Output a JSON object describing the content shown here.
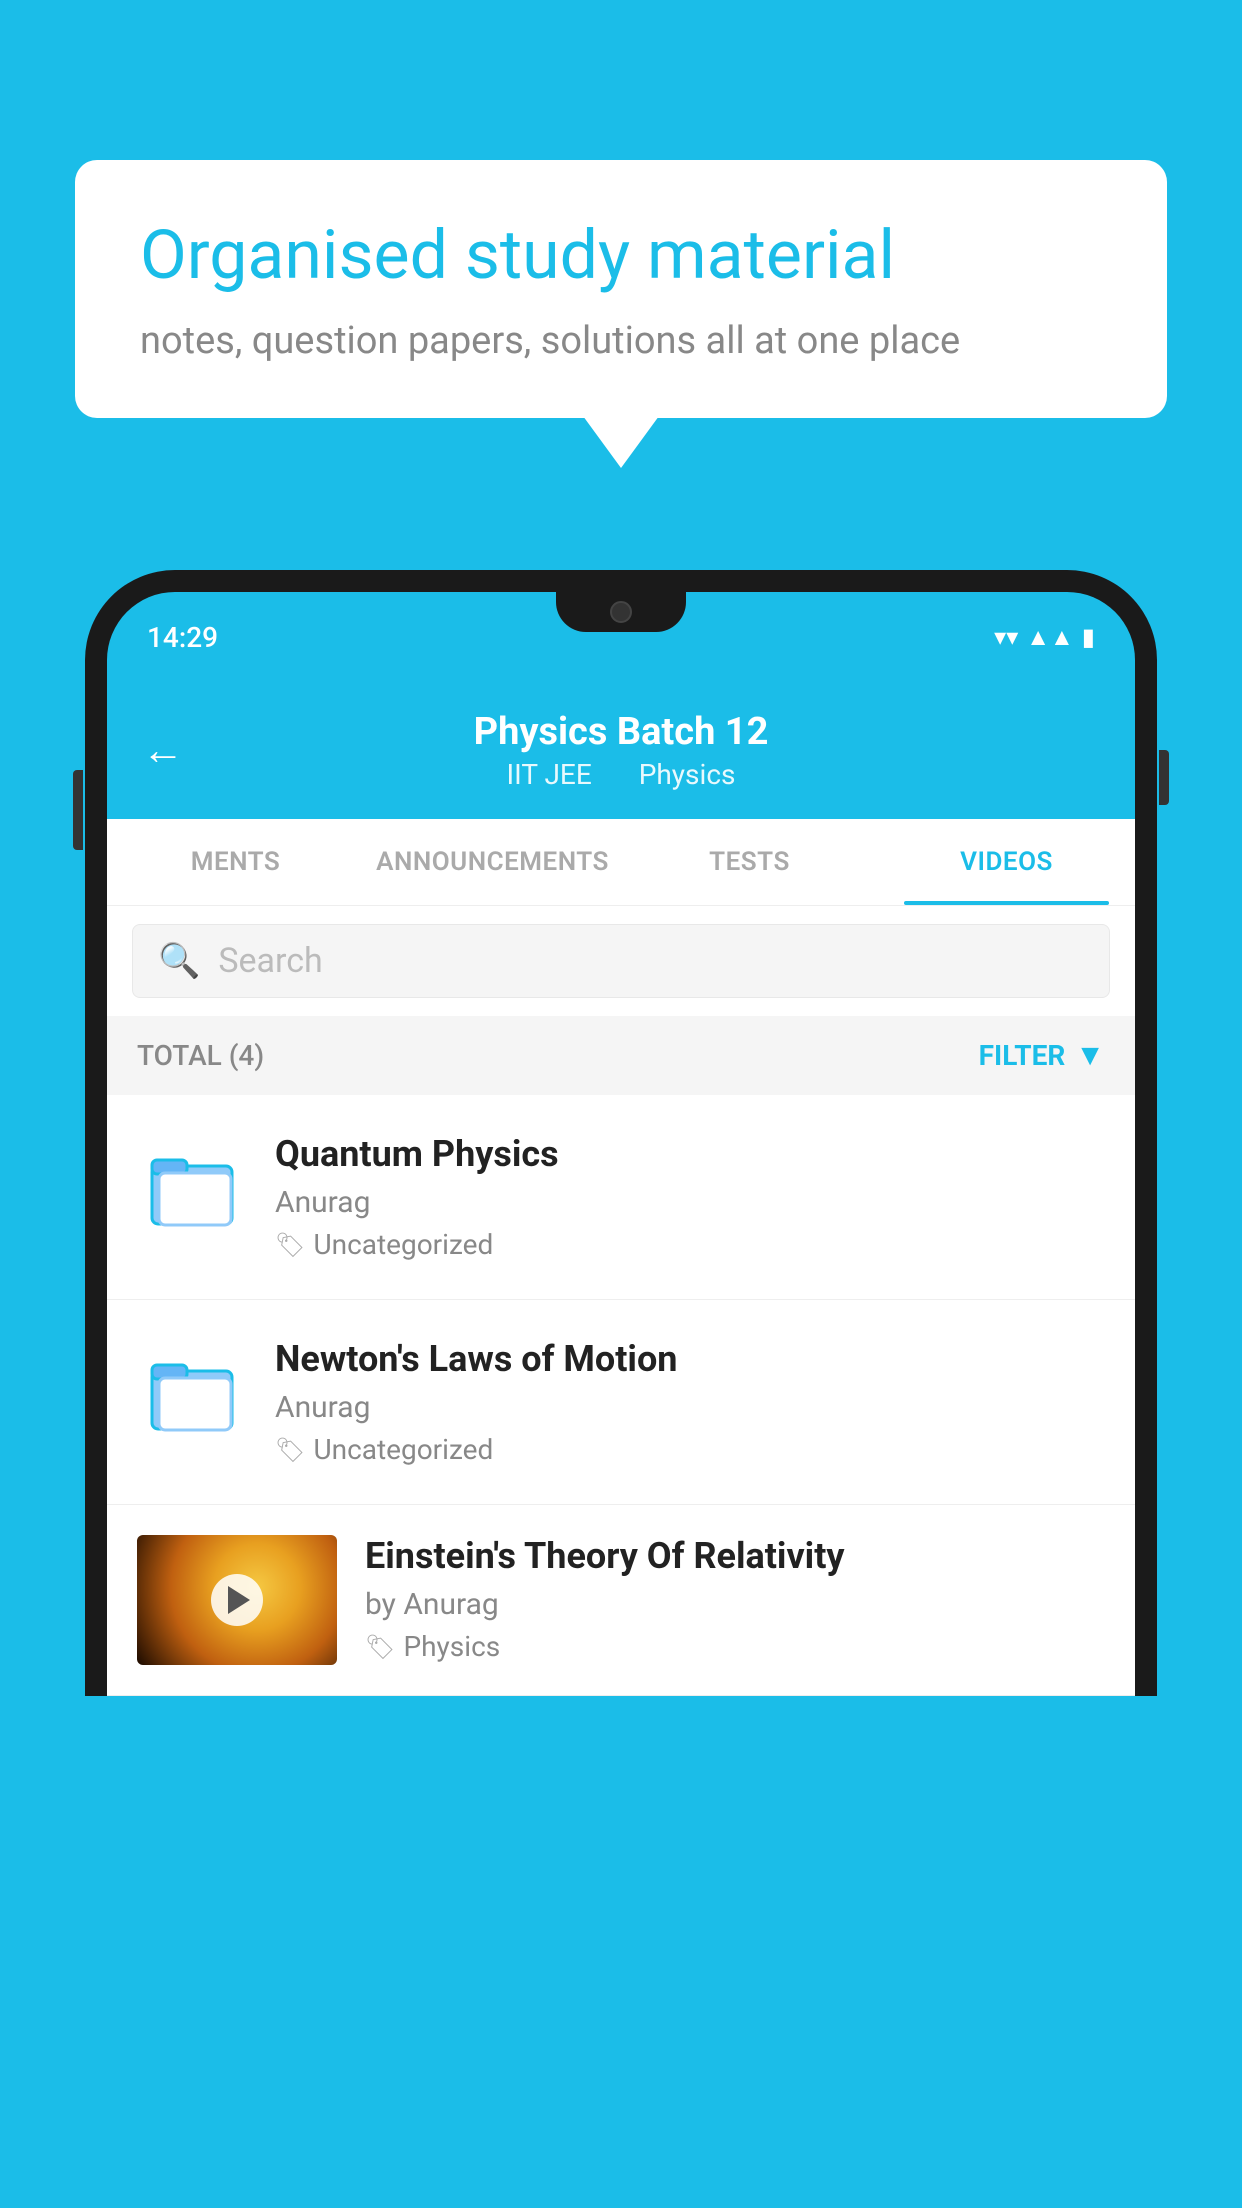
{
  "bubble": {
    "title": "Organised study material",
    "subtitle": "notes, question papers, solutions all at one place"
  },
  "phone": {
    "status_time": "14:29",
    "header": {
      "title": "Physics Batch 12",
      "subtitle_left": "IIT JEE",
      "subtitle_right": "Physics"
    },
    "tabs": [
      {
        "label": "MENTS",
        "active": false
      },
      {
        "label": "ANNOUNCEMENTS",
        "active": false
      },
      {
        "label": "TESTS",
        "active": false
      },
      {
        "label": "VIDEOS",
        "active": true
      }
    ],
    "search_placeholder": "Search",
    "filter_label": "FILTER",
    "total_label": "TOTAL (4)",
    "videos": [
      {
        "title": "Quantum Physics",
        "author": "Anurag",
        "tag": "Uncategorized",
        "has_thumbnail": false
      },
      {
        "title": "Newton's Laws of Motion",
        "author": "Anurag",
        "tag": "Uncategorized",
        "has_thumbnail": false
      },
      {
        "title": "Einstein's Theory Of Relativity",
        "author": "by Anurag",
        "tag": "Physics",
        "has_thumbnail": true
      }
    ]
  }
}
